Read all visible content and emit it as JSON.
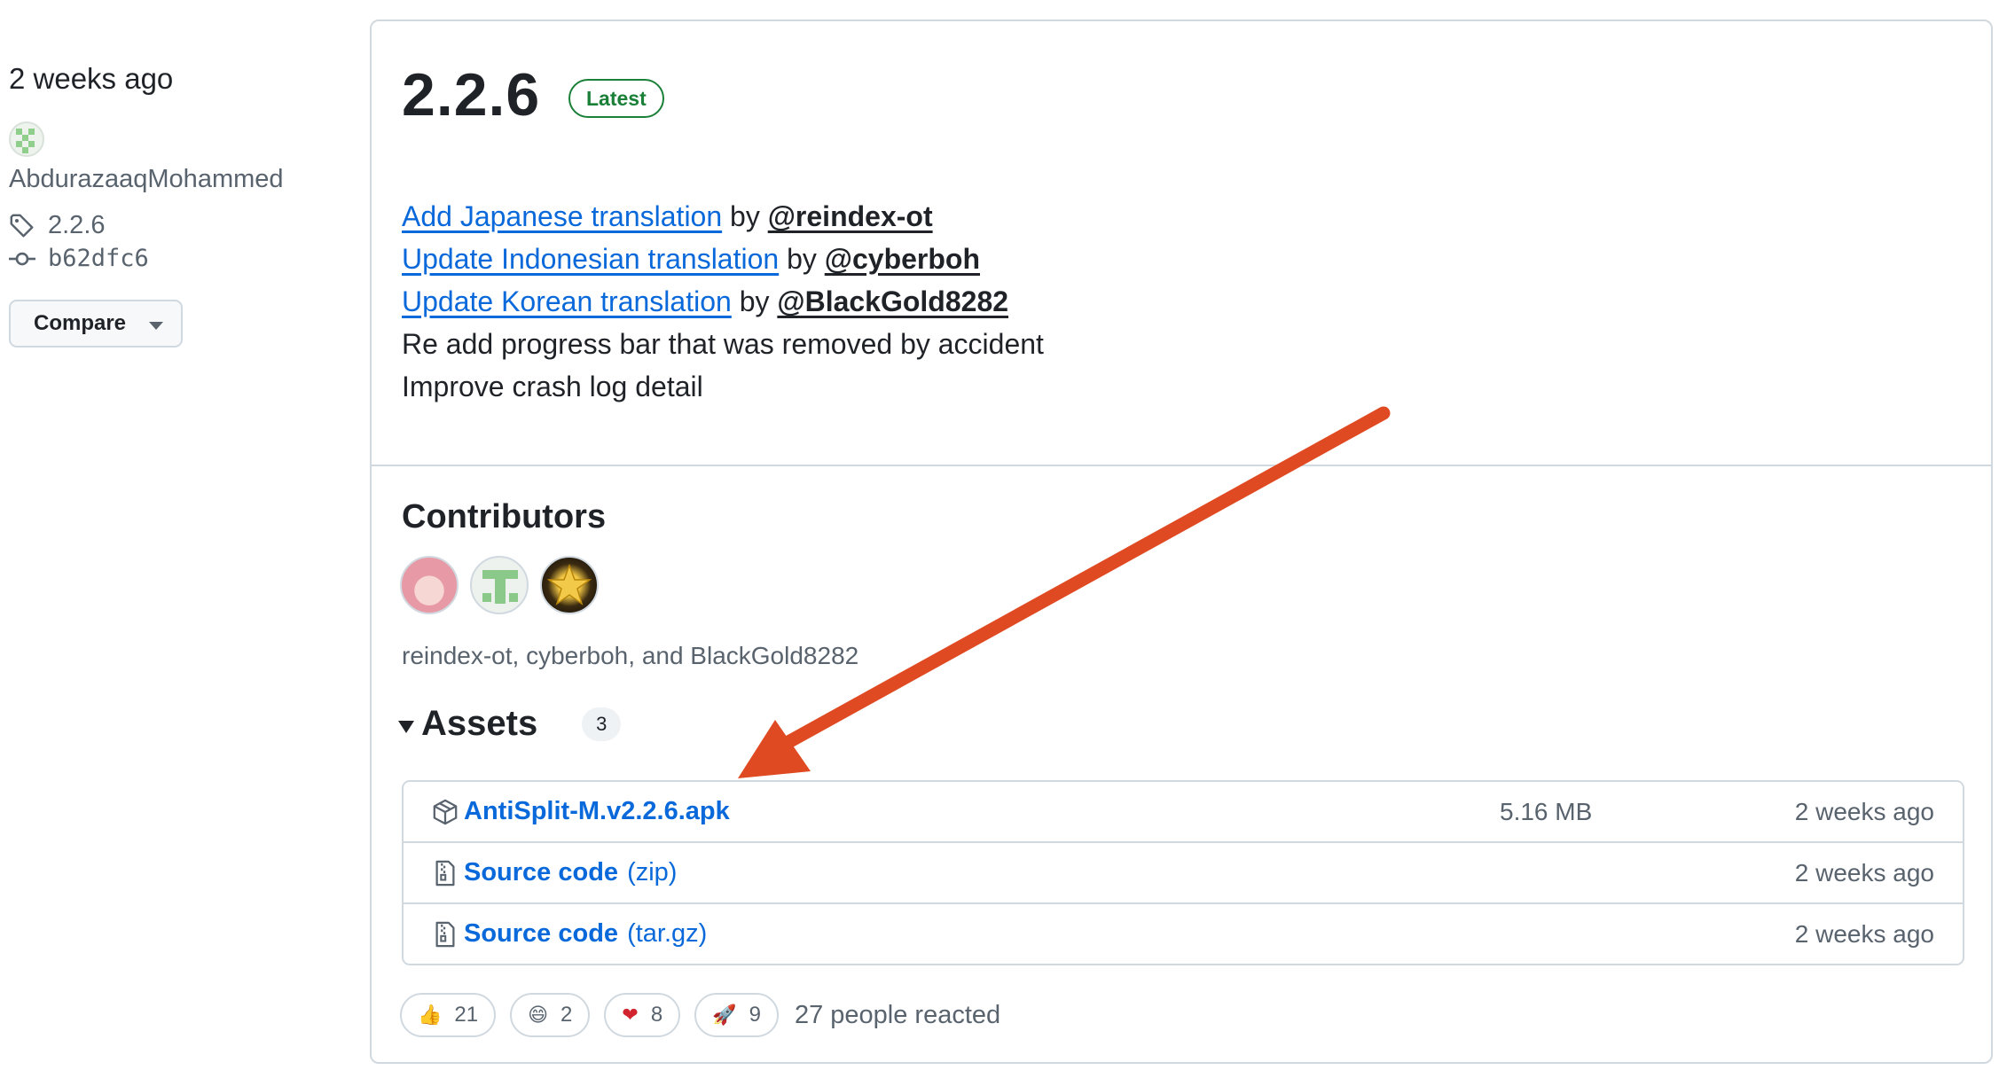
{
  "sidebar": {
    "time": "2 weeks ago",
    "author": "AbdurazaaqMohammed",
    "tag": "2.2.6",
    "commit": "b62dfc6",
    "compare_label": "Compare"
  },
  "release": {
    "version": "2.2.6",
    "badge": "Latest",
    "notes": [
      {
        "link": "Add Japanese translation",
        "by": "by",
        "mention": "@reindex-ot"
      },
      {
        "link": "Update Indonesian translation",
        "by": "by",
        "mention": "@cyberboh"
      },
      {
        "link": "Update Korean translation",
        "by": "by",
        "mention": "@BlackGold8282"
      },
      {
        "text": "Re add progress bar that was removed by accident"
      },
      {
        "text": "Improve crash log detail"
      }
    ]
  },
  "contributors": {
    "title": "Contributors",
    "names": "reindex-ot, cyberboh, and BlackGold8282"
  },
  "assets": {
    "title": "Assets",
    "count": "3",
    "items": [
      {
        "name": "AntiSplit-M.v2.2.6.apk",
        "suffix": "",
        "size": "5.16 MB",
        "date": "2 weeks ago",
        "icon": "package-icon"
      },
      {
        "name": "Source code",
        "suffix": "(zip)",
        "size": "",
        "date": "2 weeks ago",
        "icon": "file-zip-icon"
      },
      {
        "name": "Source code",
        "suffix": "(tar.gz)",
        "size": "",
        "date": "2 weeks ago",
        "icon": "file-zip-icon"
      }
    ]
  },
  "reactions": {
    "items": [
      {
        "emoji": "👍",
        "icon": "thumbs-up-icon",
        "count": "21"
      },
      {
        "emoji": "😄",
        "icon": "laugh-icon",
        "count": "2"
      },
      {
        "emoji": "❤",
        "icon": "heart-icon",
        "count": "8"
      },
      {
        "emoji": "🚀",
        "icon": "rocket-icon",
        "count": "9"
      }
    ],
    "summary": "27 people reacted"
  },
  "colors": {
    "link": "#0969da",
    "latest_badge": "#1a7f37",
    "annotation_arrow": "#e04a22",
    "border": "#d1d9e0"
  }
}
